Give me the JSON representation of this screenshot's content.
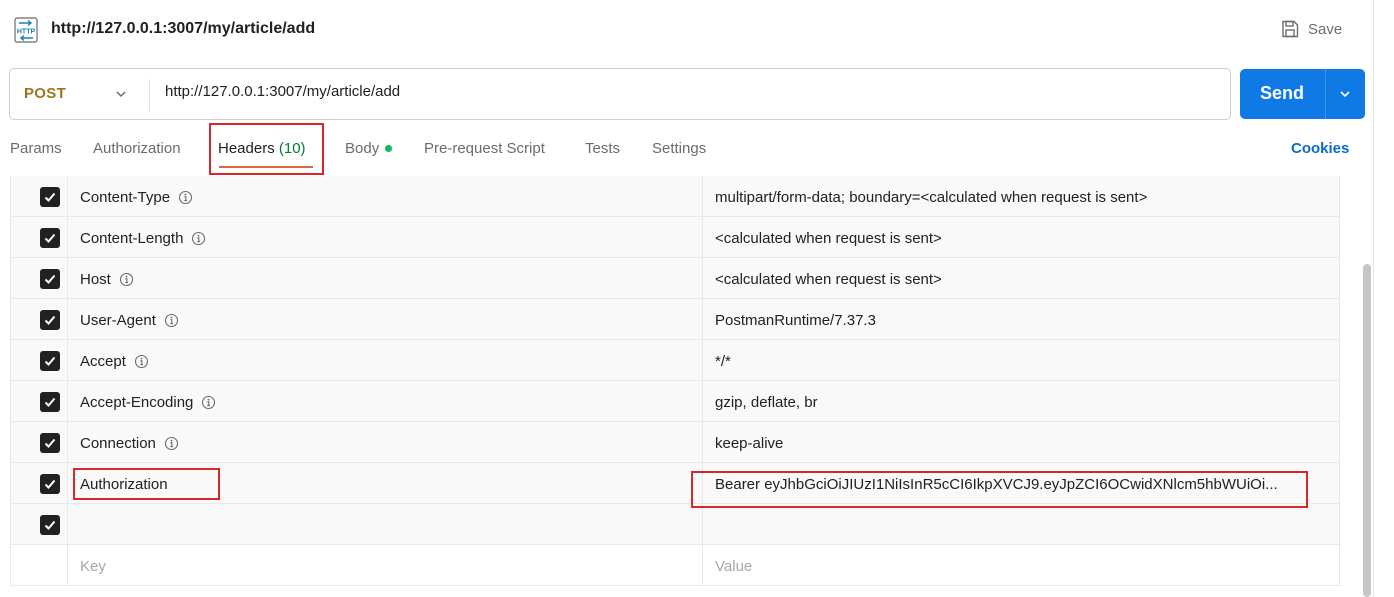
{
  "request": {
    "title": "http://127.0.0.1:3007/my/article/add",
    "save_label": "Save",
    "method": "POST",
    "url": "http://127.0.0.1:3007/my/article/add",
    "send_label": "Send"
  },
  "tabs": [
    {
      "label": "Params"
    },
    {
      "label": "Authorization"
    },
    {
      "label": "Headers",
      "count": "(10)"
    },
    {
      "label": "Body"
    },
    {
      "label": "Pre-request Script"
    },
    {
      "label": "Tests"
    },
    {
      "label": "Settings"
    }
  ],
  "cookies_label": "Cookies",
  "headers": [
    {
      "key": "Content-Type",
      "value": "multipart/form-data; boundary=<calculated when request is sent>",
      "checked": true,
      "info": true
    },
    {
      "key": "Content-Length",
      "value": "<calculated when request is sent>",
      "checked": true,
      "info": true
    },
    {
      "key": "Host",
      "value": "<calculated when request is sent>",
      "checked": true,
      "info": true
    },
    {
      "key": "User-Agent",
      "value": "PostmanRuntime/7.37.3",
      "checked": true,
      "info": true
    },
    {
      "key": "Accept",
      "value": "*/*",
      "checked": true,
      "info": true
    },
    {
      "key": "Accept-Encoding",
      "value": "gzip, deflate, br",
      "checked": true,
      "info": true
    },
    {
      "key": "Connection",
      "value": "keep-alive",
      "checked": true,
      "info": true
    },
    {
      "key": "Authorization",
      "value": "Bearer eyJhbGciOiJIUzI1NiIsInR5cCI6IkpXVCJ9.eyJpZCI6OCwidXNlcm5hbWUiOi...",
      "checked": true,
      "info": false
    },
    {
      "key": "",
      "value": "",
      "checked": true,
      "info": false
    }
  ],
  "new_row": {
    "key_placeholder": "Key",
    "value_placeholder": "Value"
  },
  "colors": {
    "accent_send": "#0f7ae5",
    "method_post": "#a0751a",
    "active_underline": "#e0663a",
    "highlight_box": "#d9262a",
    "body_dot": "#0cbb52"
  }
}
